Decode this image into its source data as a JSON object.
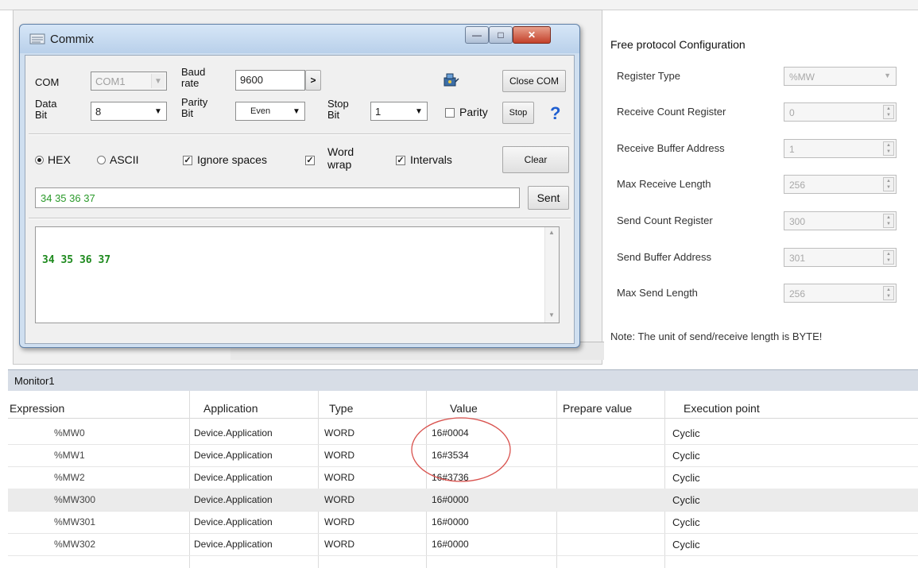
{
  "commix": {
    "title": "Commix",
    "min_glyph": "—",
    "max_glyph": "□",
    "close_glyph": "✕",
    "com_label": "COM",
    "com_value": "COM1",
    "baud_label_1": "Baud",
    "baud_label_2": "rate",
    "baud_value": "9600",
    "baud_arrow": ">",
    "close_com_button": "Close COM",
    "data_bit_label_1": "Data",
    "data_bit_label_2": "Bit",
    "data_bit_value": "8",
    "parity_bit_label_1": "Parity",
    "parity_bit_label_2": "Bit",
    "parity_bit_value": "Even",
    "stop_bit_label_1": "Stop",
    "stop_bit_label_2": "Bit",
    "stop_bit_value": "1",
    "parity_check_label": "Parity",
    "stop_button": "Stop",
    "help_glyph": "?",
    "hex_label": "HEX",
    "ascii_label": "ASCII",
    "ignore_spaces_label": "Ignore spaces",
    "word_wrap_label_1": "Word",
    "word_wrap_label_2": "wrap",
    "intervals_label": "Intervals",
    "clear_button": "Clear",
    "send_input_value": "34 35 36 37",
    "send_button": "Sent",
    "receive_text": "34  35  36  37",
    "check_glyph": "✓"
  },
  "config": {
    "title": "Free protocol Configuration",
    "fields": [
      {
        "label": "Register Type",
        "value": "%MW"
      },
      {
        "label": "Receive Count Register",
        "value": "0"
      },
      {
        "label": "Receive Buffer Address",
        "value": "1"
      },
      {
        "label": "Max Receive Length",
        "value": "256"
      },
      {
        "label": "Send Count Register",
        "value": "300"
      },
      {
        "label": "Send Buffer Address",
        "value": "301"
      },
      {
        "label": "Max Send Length",
        "value": "256"
      }
    ],
    "note": "Note: The unit of send/receive length is BYTE!"
  },
  "monitor": {
    "title": "Monitor1",
    "columns": [
      "Expression",
      "Application",
      "Type",
      "Value",
      "Prepare value",
      "Execution point"
    ],
    "rows": [
      {
        "expression": "%MW0",
        "application": "Device.Application",
        "type": "WORD",
        "value": "16#0004",
        "prepare": "",
        "exec": "Cyclic"
      },
      {
        "expression": "%MW1",
        "application": "Device.Application",
        "type": "WORD",
        "value": "16#3534",
        "prepare": "",
        "exec": "Cyclic"
      },
      {
        "expression": "%MW2",
        "application": "Device.Application",
        "type": "WORD",
        "value": "16#3736",
        "prepare": "",
        "exec": "Cyclic"
      },
      {
        "expression": "%MW300",
        "application": "Device.Application",
        "type": "WORD",
        "value": "16#0000",
        "prepare": "",
        "exec": "Cyclic"
      },
      {
        "expression": "%MW301",
        "application": "Device.Application",
        "type": "WORD",
        "value": "16#0000",
        "prepare": "",
        "exec": "Cyclic"
      },
      {
        "expression": "%MW302",
        "application": "Device.Application",
        "type": "WORD",
        "value": "16#0000",
        "prepare": "",
        "exec": "Cyclic"
      }
    ],
    "highlight_color": "#d9534f"
  }
}
